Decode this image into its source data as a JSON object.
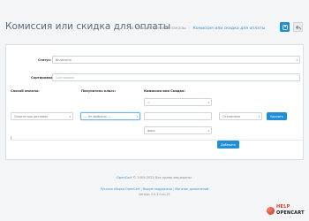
{
  "header": {
    "title": "Комиссия или скидка для оплаты",
    "breadcrumb": [
      "Общие тренинг-заказы",
      "Комиссия или скидка для оплаты"
    ]
  },
  "form": {
    "status_label": "Статус:",
    "status_value": "Включено",
    "sort_label": "Сортировка:",
    "sort_placeholder": "Сортировка",
    "columns": {
      "payment": "Способ оплаты:",
      "customer_group": "Покупатель класс:",
      "commission": "Комиссия или Скидка:"
    },
    "row": {
      "commission_type": "=",
      "payment_value": "Оплата при доставке",
      "group_value": "--- Не выбрано ---",
      "percent_value": "Отключено",
      "delete_label": "Удалить",
      "fixed_value": "фикс"
    },
    "add_label": "Добавить"
  },
  "footer": {
    "brand_link": "OpenCart",
    "copyright": "© 2009-2022 Все права защищены.",
    "links": [
      "Русская сборка OpenCart",
      "Форум поддержки",
      "Магазин дополнений"
    ],
    "version": "Version 3.0.3.0-ru.21"
  },
  "logo": {
    "line1": "HELP",
    "line2": "OPENCART"
  },
  "colors": {
    "accent": "#1e8fd6",
    "background": "#f3f5f7",
    "logo_red": "#d13b25"
  }
}
